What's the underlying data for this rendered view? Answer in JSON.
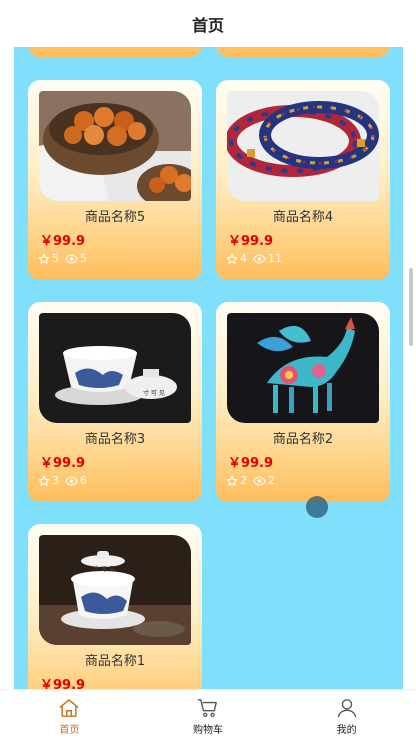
{
  "header": {
    "title": "首页"
  },
  "products": [
    {
      "name": "商品名称5",
      "price": "￥99.9",
      "stars": "5",
      "views": "5",
      "image": "oranges-basket-photo"
    },
    {
      "name": "商品名称4",
      "price": "￥99.9",
      "stars": "4",
      "views": "11",
      "image": "cloisonne-bracelets-photo"
    },
    {
      "name": "商品名称3",
      "price": "￥99.9",
      "stars": "3",
      "views": "6",
      "image": "porcelain-teacup-photo"
    },
    {
      "name": "商品名称2",
      "price": "￥99.9",
      "stars": "2",
      "views": "2",
      "image": "alebrije-figure-photo"
    },
    {
      "name": "商品名称1",
      "price": "￥99.9",
      "image": "porcelain-tea-set-photo"
    }
  ],
  "icons": {
    "star": "star-icon",
    "views": "eye-icon"
  },
  "tabbar": {
    "items": [
      {
        "label": "首页",
        "icon": "home-icon",
        "active": true
      },
      {
        "label": "购物车",
        "icon": "cart-icon",
        "active": false
      },
      {
        "label": "我的",
        "icon": "user-icon",
        "active": false
      }
    ]
  },
  "colors": {
    "background": "#80e0fb",
    "price": "#e00000",
    "active_tab": "#c8731e",
    "card_gradient_end": "#ffbd5b"
  }
}
